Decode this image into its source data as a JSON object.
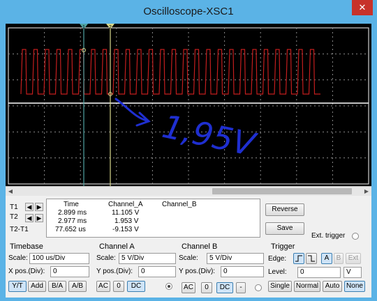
{
  "window": {
    "title": "Oscilloscope-XSC1",
    "close_glyph": "✕"
  },
  "screen": {
    "colors": {
      "channel_a": "#c21e1e",
      "channel_b": "#ffffff",
      "cursor_t1": "#4fa3a3",
      "cursor_t2": "#d8d88c",
      "annotation": "#1f2fd0",
      "grid": "#8a8a8a"
    },
    "cursor_t1_label": "1",
    "cursor_t2_label": "2",
    "annotation_text": "1,95V"
  },
  "readout": {
    "col_time": "Time",
    "col_a": "Channel_A",
    "col_b": "Channel_B",
    "rows": [
      {
        "label": "T1",
        "time": "2.899 ms",
        "a": "11.105 V",
        "b": ""
      },
      {
        "label": "T2",
        "time": "2.977 ms",
        "a": "1.953 V",
        "b": ""
      },
      {
        "label": "T2-T1",
        "time": "77.652 us",
        "a": "-9.153 V",
        "b": ""
      }
    ]
  },
  "buttons": {
    "reverse": "Reverse",
    "save": "Save",
    "ext_trigger": "Ext. trigger"
  },
  "timebase": {
    "title": "Timebase",
    "scale_label": "Scale:",
    "scale": "100 us/Div",
    "xpos_label": "X pos.(Div):",
    "xpos": "0",
    "modes": [
      "Y/T",
      "Add",
      "B/A",
      "A/B"
    ]
  },
  "channel_a": {
    "title": "Channel A",
    "scale_label": "Scale:",
    "scale": "5  V/Div",
    "ypos_label": "Y pos.(Div):",
    "ypos": "0",
    "coupling": [
      "AC",
      "0",
      "DC"
    ]
  },
  "channel_b": {
    "title": "Channel B",
    "scale_label": "Scale:",
    "scale": "5  V/Div",
    "ypos_label": "Y pos.(Div):",
    "ypos": "0",
    "coupling": [
      "AC",
      "0",
      "DC",
      "-"
    ]
  },
  "trigger": {
    "title": "Trigger",
    "edge_label": "Edge:",
    "level_label": "Level:",
    "level": "0",
    "level_unit": "V",
    "sources": [
      "A",
      "B",
      "Ext"
    ],
    "modes": [
      "Single",
      "Normal",
      "Auto",
      "None"
    ]
  }
}
